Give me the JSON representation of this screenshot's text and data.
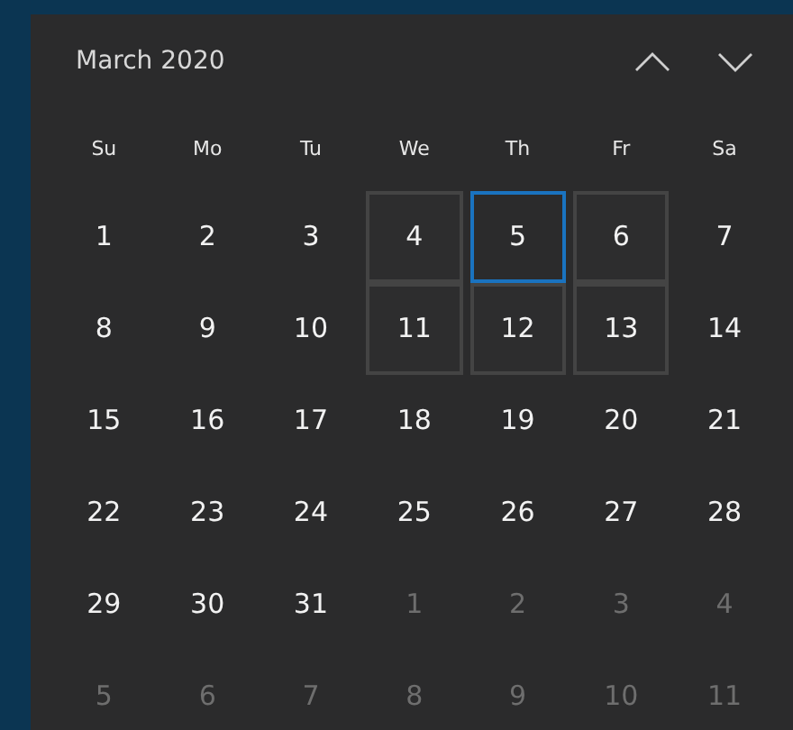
{
  "header": {
    "title": "March 2020"
  },
  "weekdays": [
    "Su",
    "Mo",
    "Tu",
    "We",
    "Th",
    "Fr",
    "Sa"
  ],
  "weeks": [
    [
      {
        "day": "1",
        "in_month": true,
        "today": false,
        "glow": false
      },
      {
        "day": "2",
        "in_month": true,
        "today": false,
        "glow": false
      },
      {
        "day": "3",
        "in_month": true,
        "today": false,
        "glow": false
      },
      {
        "day": "4",
        "in_month": true,
        "today": false,
        "glow": true
      },
      {
        "day": "5",
        "in_month": true,
        "today": true,
        "glow": false
      },
      {
        "day": "6",
        "in_month": true,
        "today": false,
        "glow": true
      },
      {
        "day": "7",
        "in_month": true,
        "today": false,
        "glow": false
      }
    ],
    [
      {
        "day": "8",
        "in_month": true,
        "today": false,
        "glow": false
      },
      {
        "day": "9",
        "in_month": true,
        "today": false,
        "glow": false
      },
      {
        "day": "10",
        "in_month": true,
        "today": false,
        "glow": false
      },
      {
        "day": "11",
        "in_month": true,
        "today": false,
        "glow": true
      },
      {
        "day": "12",
        "in_month": true,
        "today": false,
        "glow": true
      },
      {
        "day": "13",
        "in_month": true,
        "today": false,
        "glow": true
      },
      {
        "day": "14",
        "in_month": true,
        "today": false,
        "glow": false
      }
    ],
    [
      {
        "day": "15",
        "in_month": true,
        "today": false,
        "glow": false
      },
      {
        "day": "16",
        "in_month": true,
        "today": false,
        "glow": false
      },
      {
        "day": "17",
        "in_month": true,
        "today": false,
        "glow": false
      },
      {
        "day": "18",
        "in_month": true,
        "today": false,
        "glow": false
      },
      {
        "day": "19",
        "in_month": true,
        "today": false,
        "glow": false
      },
      {
        "day": "20",
        "in_month": true,
        "today": false,
        "glow": false
      },
      {
        "day": "21",
        "in_month": true,
        "today": false,
        "glow": false
      }
    ],
    [
      {
        "day": "22",
        "in_month": true,
        "today": false,
        "glow": false
      },
      {
        "day": "23",
        "in_month": true,
        "today": false,
        "glow": false
      },
      {
        "day": "24",
        "in_month": true,
        "today": false,
        "glow": false
      },
      {
        "day": "25",
        "in_month": true,
        "today": false,
        "glow": false
      },
      {
        "day": "26",
        "in_month": true,
        "today": false,
        "glow": false
      },
      {
        "day": "27",
        "in_month": true,
        "today": false,
        "glow": false
      },
      {
        "day": "28",
        "in_month": true,
        "today": false,
        "glow": false
      }
    ],
    [
      {
        "day": "29",
        "in_month": true,
        "today": false,
        "glow": false
      },
      {
        "day": "30",
        "in_month": true,
        "today": false,
        "glow": false
      },
      {
        "day": "31",
        "in_month": true,
        "today": false,
        "glow": false
      },
      {
        "day": "1",
        "in_month": false,
        "today": false,
        "glow": false
      },
      {
        "day": "2",
        "in_month": false,
        "today": false,
        "glow": false
      },
      {
        "day": "3",
        "in_month": false,
        "today": false,
        "glow": false
      },
      {
        "day": "4",
        "in_month": false,
        "today": false,
        "glow": false
      }
    ],
    [
      {
        "day": "5",
        "in_month": false,
        "today": false,
        "glow": false
      },
      {
        "day": "6",
        "in_month": false,
        "today": false,
        "glow": false
      },
      {
        "day": "7",
        "in_month": false,
        "today": false,
        "glow": false
      },
      {
        "day": "8",
        "in_month": false,
        "today": false,
        "glow": false
      },
      {
        "day": "9",
        "in_month": false,
        "today": false,
        "glow": false
      },
      {
        "day": "10",
        "in_month": false,
        "today": false,
        "glow": false
      },
      {
        "day": "11",
        "in_month": false,
        "today": false,
        "glow": false
      }
    ]
  ]
}
